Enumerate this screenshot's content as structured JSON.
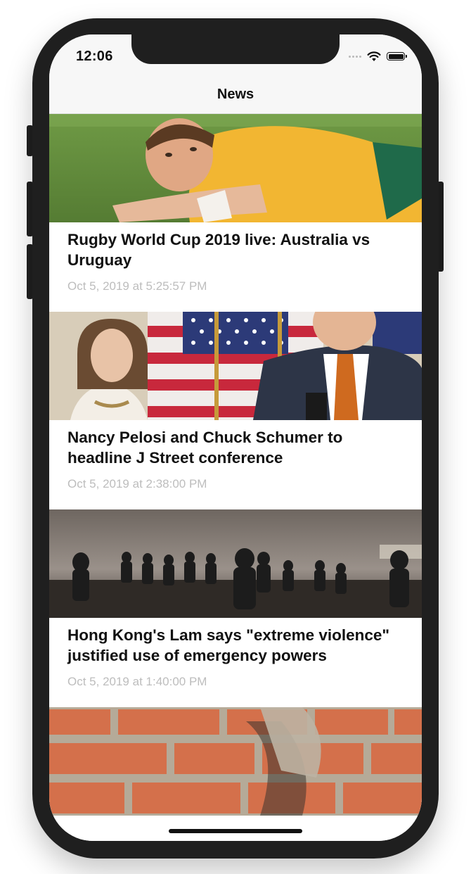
{
  "status_bar": {
    "time": "12:06"
  },
  "navbar": {
    "title": "News"
  },
  "articles": [
    {
      "title": "Rugby World Cup 2019 live: Australia vs Uruguay",
      "date": "Oct 5, 2019 at 5:25:57 PM",
      "image": "rugby-player-photo"
    },
    {
      "title": "Nancy Pelosi and Chuck Schumer to headline J Street conference",
      "date": "Oct 5, 2019 at 2:38:00 PM",
      "image": "politicians-flag-photo"
    },
    {
      "title": "Hong Kong's Lam says \"extreme violence\" justified use of emergency powers",
      "date": "Oct 5, 2019 at 1:40:00 PM",
      "image": "riot-police-photo"
    },
    {
      "title": "",
      "date": "",
      "image": "brick-wall-photo"
    }
  ]
}
